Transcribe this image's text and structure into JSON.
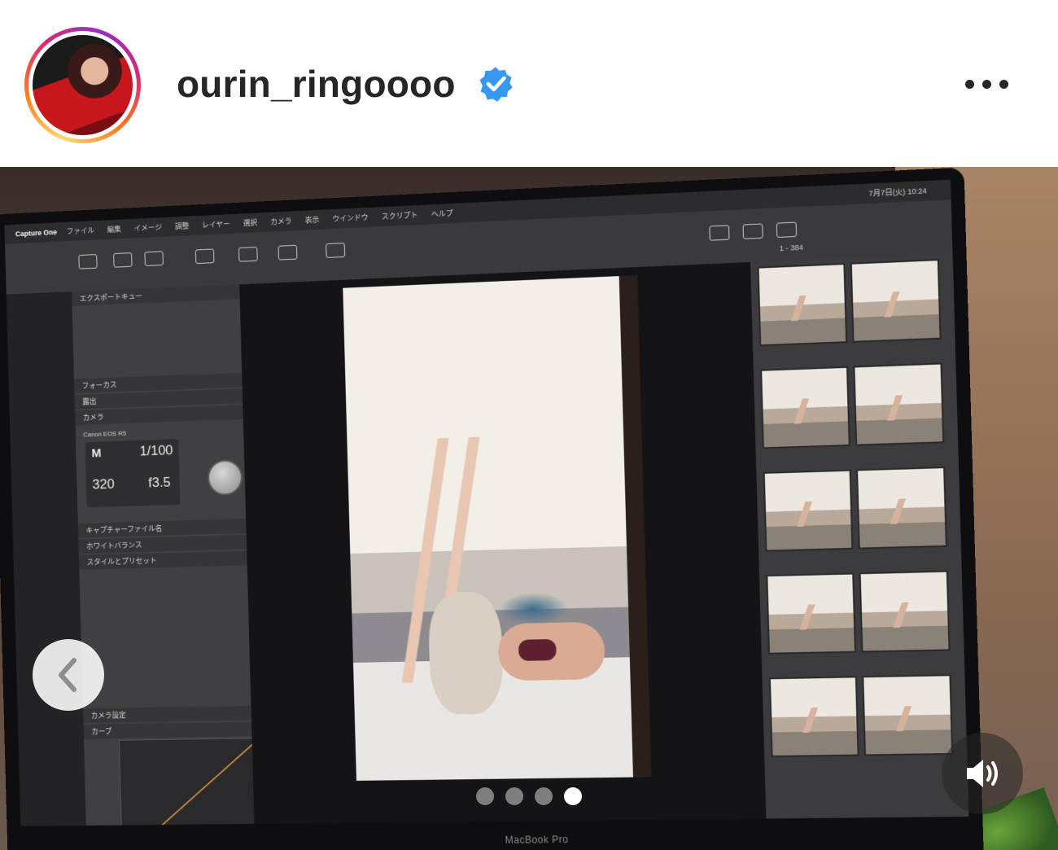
{
  "post": {
    "username": "ourin_ringoooo",
    "verified": true,
    "verified_color": "#3897f0"
  },
  "screen": {
    "app_name": "Capture One",
    "menu": [
      "ファイル",
      "編集",
      "イメージ",
      "調整",
      "レイヤー",
      "選択",
      "カメラ",
      "表示",
      "ウインドウ",
      "スクリプト",
      "ヘルプ"
    ],
    "clock": "7月7日(火) 10:24",
    "range": "1 - 384",
    "panel_sections": [
      "エクスポートキュー",
      "フォーカス",
      "露出",
      "カメラ",
      "キャプチャーファイル名",
      "ホワイトバランス",
      "スタイルとプリセット",
      "カメラ設定",
      "カーブ"
    ],
    "camera_model": "Canon EOS R5",
    "mode": "M",
    "shutter": "1/100",
    "iso": "320",
    "aperture": "f3.5",
    "brand_label": "MacBook Pro"
  },
  "carousel": {
    "total": 4,
    "active_index": 3
  }
}
